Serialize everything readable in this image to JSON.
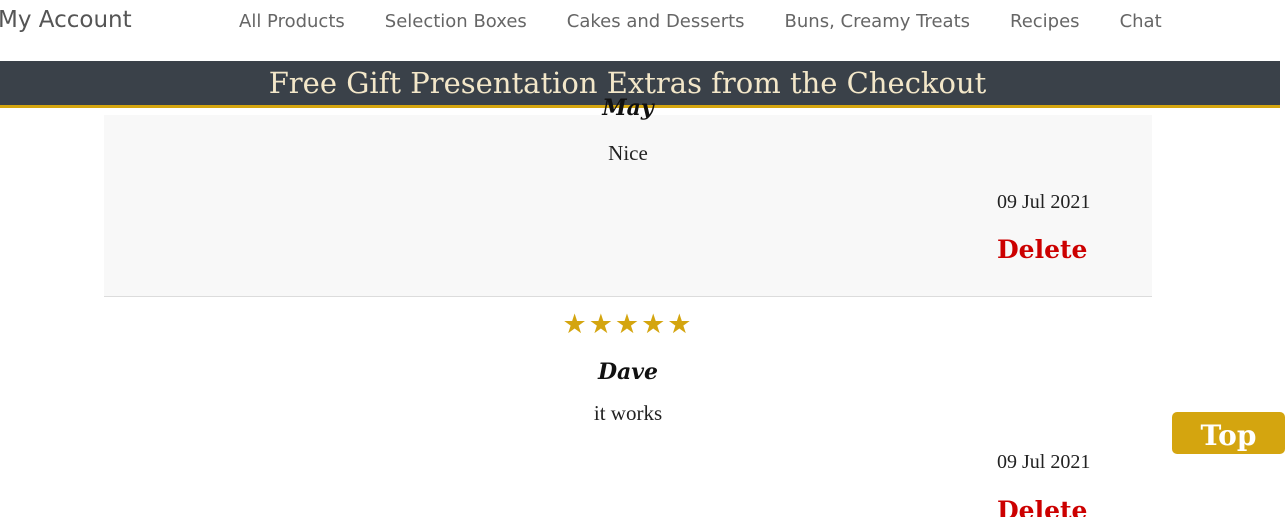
{
  "nav": {
    "account_label": "My Account",
    "links": [
      "All Products",
      "Selection Boxes",
      "Cakes and Desserts",
      "Buns, Creamy Treats",
      "Recipes",
      "Chat"
    ]
  },
  "promo": {
    "text": "Free Gift Presentation Extras from the Checkout"
  },
  "reviews": [
    {
      "reviewer": "May",
      "comment": "Nice",
      "date": "09 Jul 2021",
      "delete_label": "Delete"
    },
    {
      "stars": "★★★★★",
      "rating": 5,
      "reviewer": "Dave",
      "comment": "it works",
      "date": "09 Jul 2021",
      "delete_label": "Delete"
    }
  ],
  "top_button": {
    "label": "Top"
  },
  "colors": {
    "banner_bg": "#3a4149",
    "accent_gold": "#d4a50f",
    "delete_red": "#cc0000"
  }
}
